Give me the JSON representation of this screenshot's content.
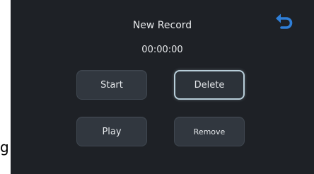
{
  "stray_label": "g",
  "screen": {
    "title": "New Record",
    "timer": "00:00:00",
    "back_icon": "back-arrow-icon",
    "accent_color": "#2f7fd8",
    "buttons": {
      "start": "Start",
      "delete": "Delete",
      "play": "Play",
      "remove": "Remove"
    },
    "selected_button": "Delete"
  }
}
